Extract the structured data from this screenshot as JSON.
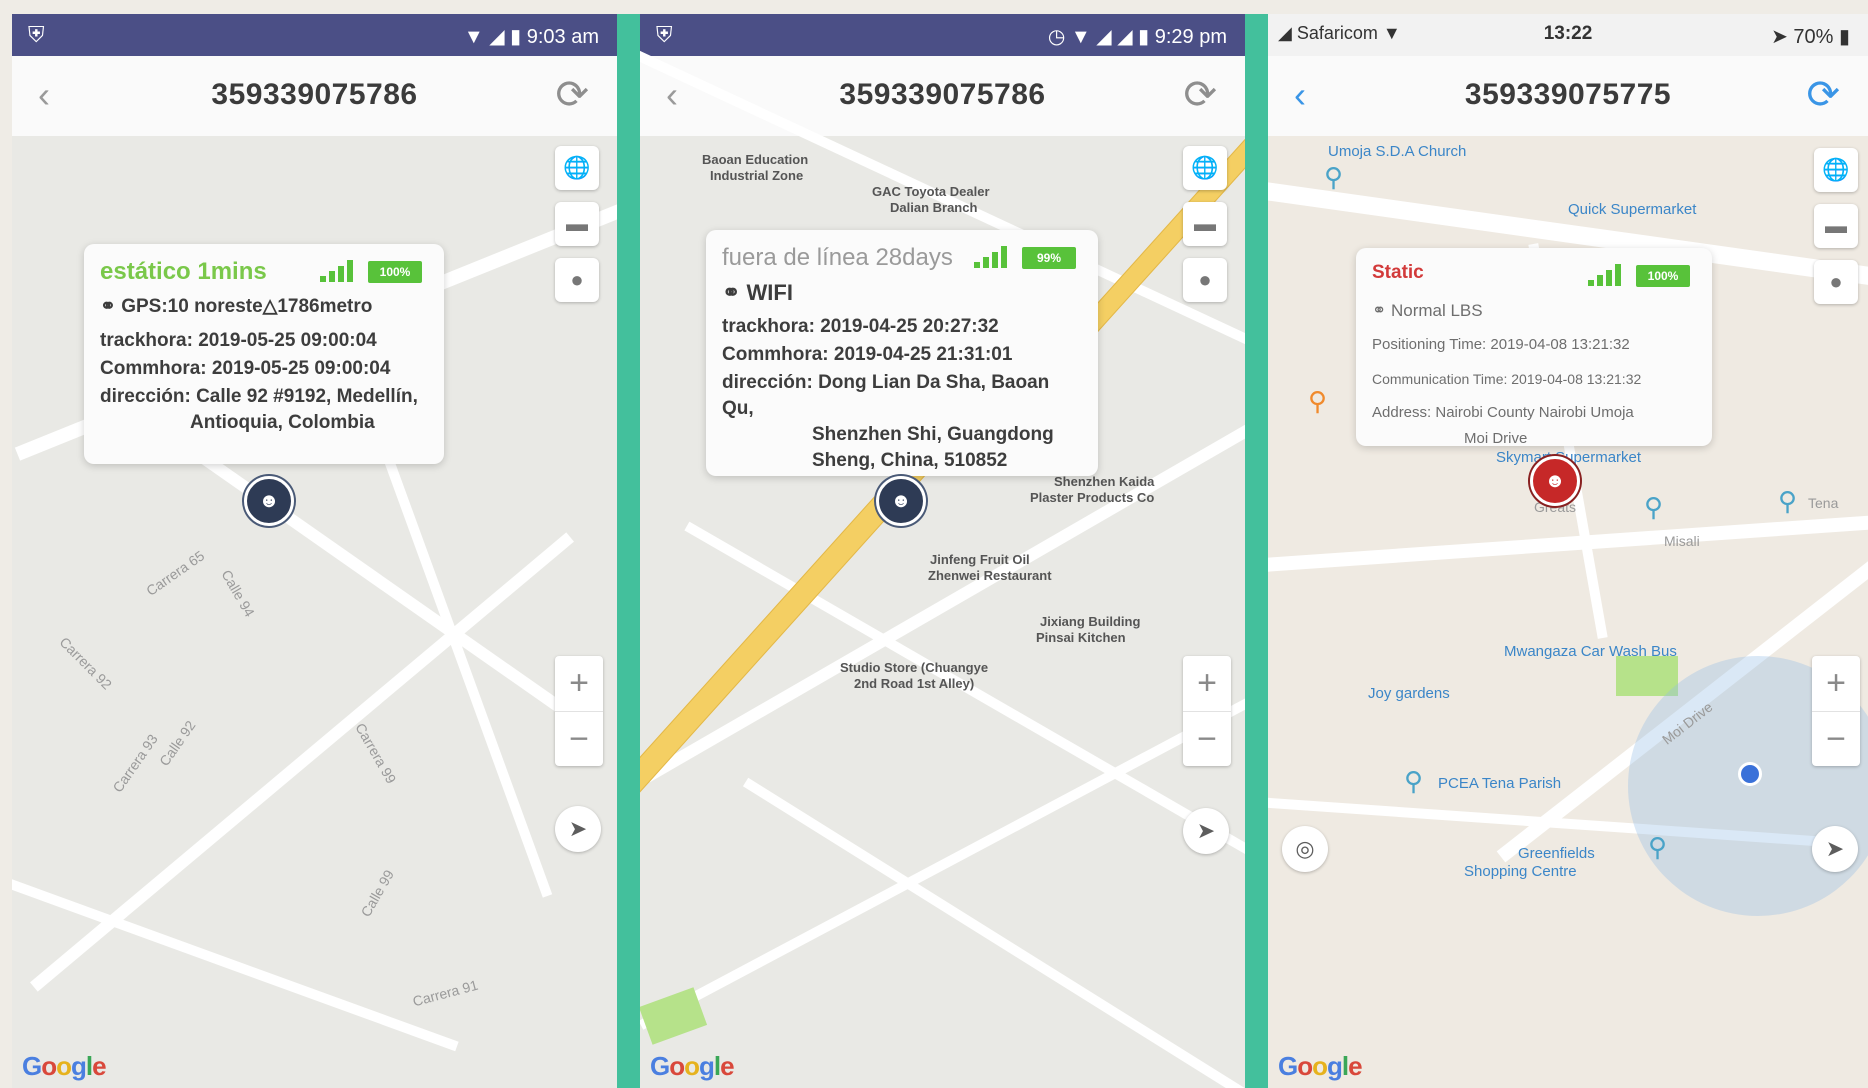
{
  "panels": [
    {
      "status_time": "9:03 am",
      "device_id": "359339075786",
      "popup": {
        "status": "estático 1mins",
        "status_color": "#7ac84a",
        "mode_line": "GPS:10 noreste△1786metro",
        "track_line": "trackhora: 2019-05-25 09:00:04",
        "comm_line": "Commhora: 2019-05-25 09:00:04",
        "address_line1": "dirección: Calle 92 #9192, Medellín,",
        "address_line2": "Antioquia, Colombia",
        "battery": "100%"
      },
      "map_labels": [
        "Carrera 65",
        "Calle 94",
        "Carrera 92",
        "Carrera 93",
        "Calle 92",
        "Carrera 99",
        "Calle 99",
        "Carrera 91"
      ],
      "google": "Google"
    },
    {
      "status_time": "9:29 pm",
      "device_id": "359339075786",
      "popup": {
        "status": "fuera de línea 28days",
        "status_color": "#9a9a9a",
        "mode_line": "WIFI",
        "track_line": "trackhora: 2019-04-25 20:27:32",
        "comm_line": "Commhora: 2019-04-25 21:31:01",
        "address_line1": "dirección: Dong Lian Da Sha, Baoan Qu,",
        "address_line2": "Shenzhen Shi, Guangdong",
        "address_line3": "Sheng, China, 510852",
        "battery": "99%"
      },
      "map_labels": [
        "Baoan Education",
        "Industrial Zone",
        "GAC Toyota Dealer",
        "Dalian Branch",
        "Jinfeng Fruit Oil",
        "Zhenwei Restaurant",
        "Jixiang Building",
        "Pinsai Kitchen",
        "Studio Store (Chuangye",
        "2nd Road 1st Alley)",
        "Shenzhen Kaida",
        "Plaster Products Co"
      ],
      "google": "Google"
    },
    {
      "carrier": "Safaricom",
      "status_time": "13:22",
      "battery_status": "70%",
      "device_id": "359339075775",
      "popup": {
        "status": "Static",
        "status_color": "#d23a3a",
        "mode_line": "Normal LBS",
        "track_line": "Positioning Time: 2019-04-08 13:21:32",
        "comm_line": "Communication Time: 2019-04-08 13:21:32",
        "address_line1": "Address: Nairobi County Nairobi Umoja",
        "address_line2": "Moi Drive",
        "battery": "100%"
      },
      "map_labels": [
        "Umoja S.D.A Church",
        "Quick Supermarket",
        "Skymart Supermarket",
        "Mwangaza Car Wash Bus",
        "Joy gardens",
        "PCEA Tena Parish",
        "Greenfields",
        "Shopping Centre",
        "Moi Drive",
        "Tena",
        "Misali",
        "Greats"
      ],
      "google": "Google"
    }
  ]
}
